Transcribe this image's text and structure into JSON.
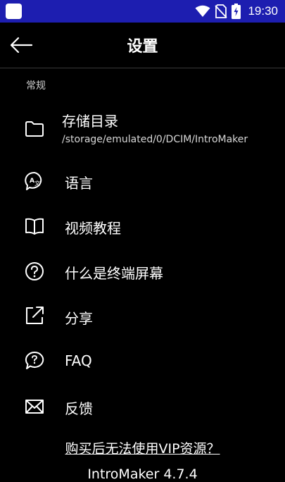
{
  "status_bar": {
    "time": "19:30",
    "icons": [
      "app-icon",
      "wifi-icon",
      "no-sim-icon",
      "battery-charging-icon"
    ]
  },
  "app_bar": {
    "title": "设置",
    "back_icon": "arrow-left-icon"
  },
  "section": {
    "label": "常规"
  },
  "items": [
    {
      "icon": "folder-icon",
      "label": "存储目录",
      "sublabel": "/storage/emulated/0/DCIM/IntroMaker"
    },
    {
      "icon": "language-icon",
      "label": "语言"
    },
    {
      "icon": "book-icon",
      "label": "视频教程"
    },
    {
      "icon": "help-circle-icon",
      "label": "什么是终端屏幕"
    },
    {
      "icon": "share-icon",
      "label": "分享"
    },
    {
      "icon": "faq-bubble-icon",
      "label": "FAQ"
    },
    {
      "icon": "mail-icon",
      "label": "反馈"
    }
  ],
  "footer": {
    "vip_link": "购买后无法使用VIP资源？",
    "version": "IntroMaker 4.7.4"
  },
  "colors": {
    "status_bar": "#1d1eb0",
    "background": "#000000",
    "text": "#ffffff"
  }
}
